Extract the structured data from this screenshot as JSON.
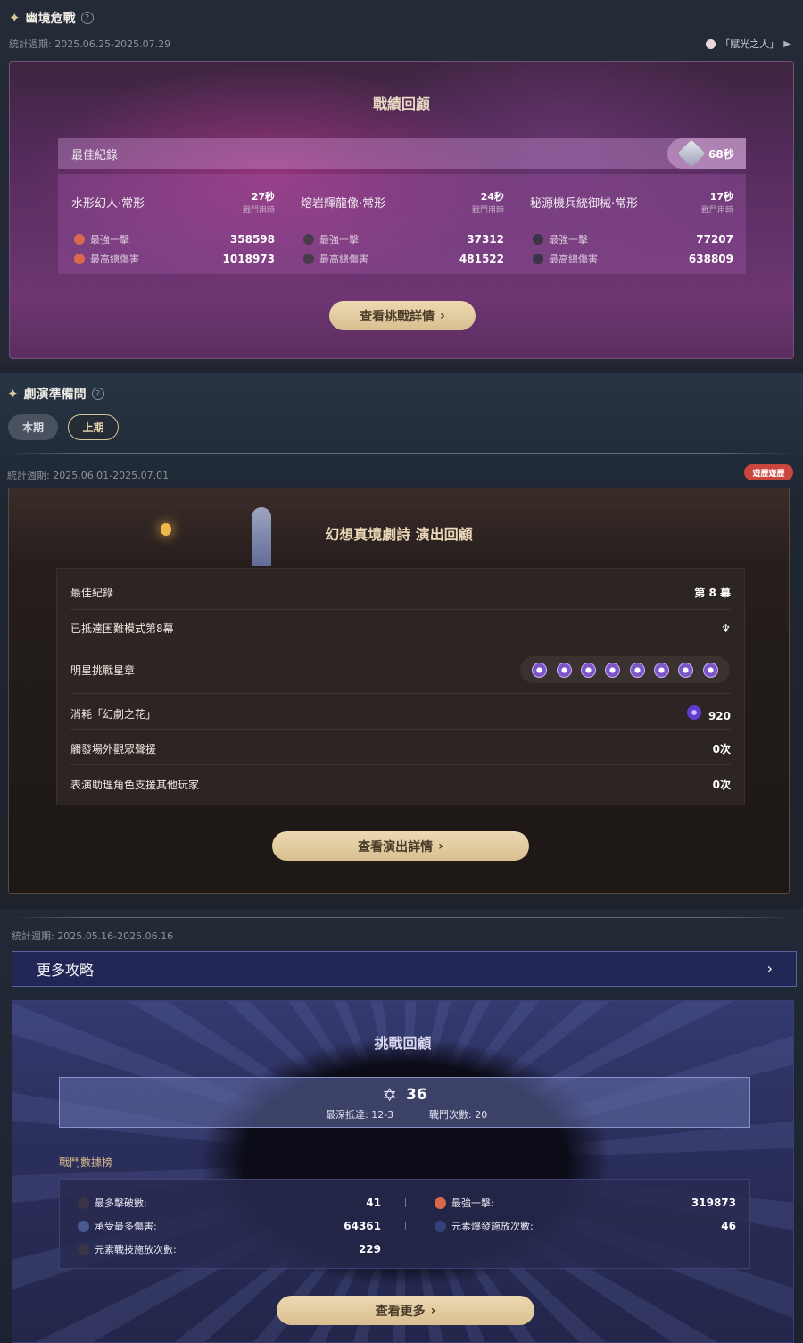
{
  "section1": {
    "title": "幽境危戰",
    "help": "?",
    "period": "統計週期: 2025.06.25-2025.07.29",
    "title_badge": "「赋光之人」",
    "panel_title": "戰績回顧",
    "best_label": "最佳紀錄",
    "best_time": "68秒",
    "bosses": [
      {
        "name": "水形幻人·常形",
        "time": "27秒",
        "time_label": "戰鬥用時",
        "stats": [
          {
            "label": "最強一擊",
            "value": "358598"
          },
          {
            "label": "最高總傷害",
            "value": "1018973"
          }
        ]
      },
      {
        "name": "熔岩輝龍像·常形",
        "time": "24秒",
        "time_label": "戰鬥用時",
        "stats": [
          {
            "label": "最強一擊",
            "value": "37312"
          },
          {
            "label": "最高總傷害",
            "value": "481522"
          }
        ]
      },
      {
        "name": "秘源機兵統御械·常形",
        "time": "17秒",
        "time_label": "戰鬥用時",
        "stats": [
          {
            "label": "最強一擊",
            "value": "77207"
          },
          {
            "label": "最高總傷害",
            "value": "638809"
          }
        ]
      }
    ],
    "button": "查看挑戰詳情"
  },
  "section2": {
    "title": "劇演準備問",
    "help": "?",
    "tabs": [
      "本期",
      "上期"
    ],
    "period": "統計週期: 2025.06.01-2025.07.01",
    "badge": "遊歷遊歷",
    "panel_title": "幻想真境劇詩 演出回顧",
    "rows": [
      {
        "label": "最佳紀錄",
        "value": "第 8 幕"
      },
      {
        "label": "已抵達困難模式第8幕",
        "value": ""
      },
      {
        "label": "明星挑戰星章",
        "value": ""
      },
      {
        "label": "消耗「幻劇之花」",
        "value": "920"
      },
      {
        "label": "觸發場外觀眾聲援",
        "value": "0次"
      },
      {
        "label": "表演助理角色支援其他玩家",
        "value": "0次"
      }
    ],
    "star_count": 8,
    "button": "查看演出詳情"
  },
  "section3": {
    "period": "統計週期: 2025.05.16-2025.06.16",
    "more_label": "更多攻略",
    "panel_title": "挑戰回顧",
    "stars": "36",
    "deepest": "最深抵達: 12-3",
    "battles": "戰鬥次數: 20",
    "rank_title": "戰鬥數據榜",
    "ranks": [
      {
        "label": "最多擊破數:",
        "value": "41"
      },
      {
        "label": "最強一擊:",
        "value": "319873"
      },
      {
        "label": "承受最多傷害:",
        "value": "64361"
      },
      {
        "label": "元素爆發施放次數:",
        "value": "46"
      },
      {
        "label": "元素戰技施放次數:",
        "value": "229"
      }
    ],
    "button": "查看更多"
  }
}
